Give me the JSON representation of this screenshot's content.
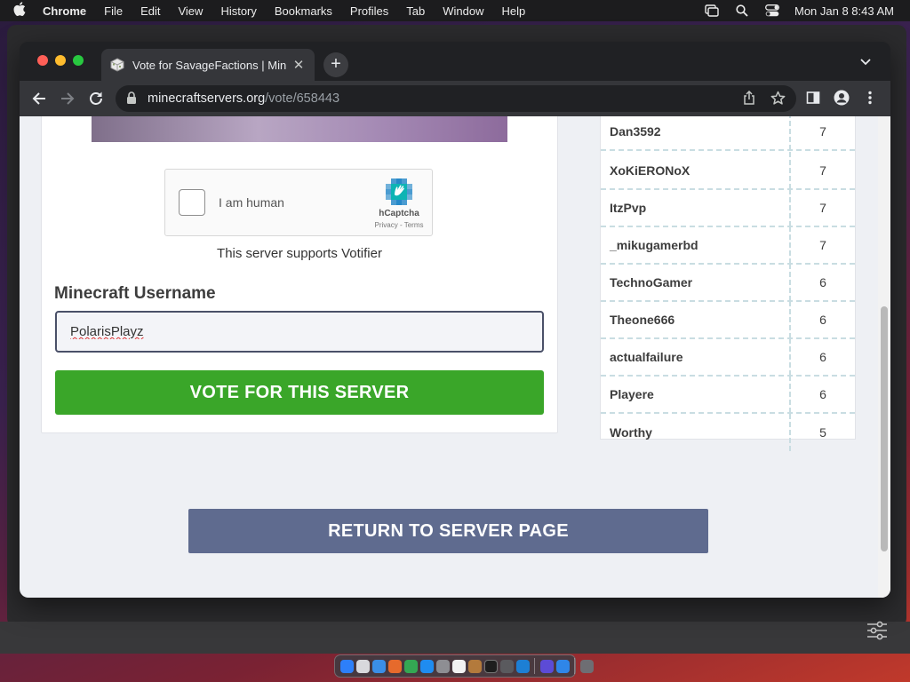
{
  "menubar": {
    "items": [
      "Chrome",
      "File",
      "Edit",
      "View",
      "History",
      "Bookmarks",
      "Profiles",
      "Tab",
      "Window",
      "Help"
    ],
    "clock": "Mon Jan 8  8:43 AM"
  },
  "browser": {
    "tab_title": "Vote for SavageFactions | Mine",
    "url_host": "minecraftservers.org",
    "url_path": "/vote/658443"
  },
  "vote_form": {
    "captcha_label": "I am human",
    "captcha_brand": "hCaptcha",
    "captcha_links": "Privacy - Terms",
    "votifier_note": "This server supports Votifier",
    "username_label": "Minecraft Username",
    "username_value": "PolarisPlayz",
    "vote_button": "VOTE FOR THIS SERVER"
  },
  "top_voters": [
    {
      "name": "Dan3592",
      "votes": "7"
    },
    {
      "name": "XoKiERONoX",
      "votes": "7"
    },
    {
      "name": "ItzPvp",
      "votes": "7"
    },
    {
      "name": "_mikugamerbd",
      "votes": "7"
    },
    {
      "name": "TechnoGamer",
      "votes": "6"
    },
    {
      "name": "Theone666",
      "votes": "6"
    },
    {
      "name": "actualfailure",
      "votes": "6"
    },
    {
      "name": "Playere",
      "votes": "6"
    },
    {
      "name": "Worthy",
      "votes": "5"
    }
  ],
  "return_button": "RETURN TO SERVER PAGE",
  "colors": {
    "vote_green": "#3aa629",
    "return_slate": "#5f6b8f",
    "page_bg": "#eef0f4"
  }
}
